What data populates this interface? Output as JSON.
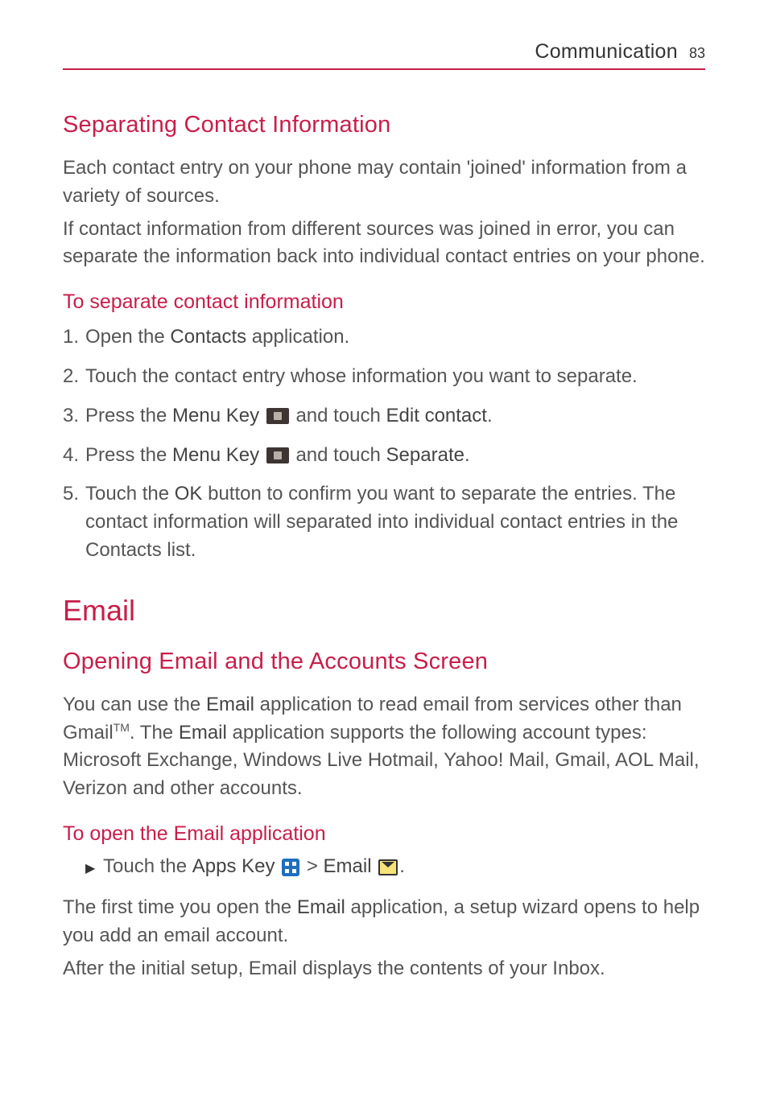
{
  "header": {
    "chapter": "Communication",
    "page": "83"
  },
  "section1": {
    "title": "Separating Contact Information",
    "para1": "Each contact entry on your phone may contain 'joined' information from a variety of sources.",
    "para2": "If contact information from different sources was joined in error, you can separate the information back into individual contact entries on your phone.",
    "sub1": "To separate contact information",
    "steps": {
      "n1": "1.",
      "s1a": "Open the ",
      "s1b": "Contacts",
      "s1c": " application.",
      "n2": "2.",
      "s2": "Touch the contact entry whose information you want to separate.",
      "n3": "3.",
      "s3a": "Press the ",
      "s3b": "Menu Key",
      "s3c": " and touch ",
      "s3d": "Edit contact",
      "s3e": ".",
      "n4": "4.",
      "s4a": "Press the ",
      "s4b": "Menu Key",
      "s4c": " and touch ",
      "s4d": "Separate",
      "s4e": ".",
      "n5": "5.",
      "s5a": "Touch the ",
      "s5b": "OK",
      "s5c": " button to confirm you want to separate the entries. The contact information will separated into individual contact entries in the Contacts list."
    }
  },
  "section2": {
    "title": "Email",
    "subtitle": "Opening Email and the Accounts Screen",
    "p1a": "You can use the ",
    "p1b": "Email",
    "p1c": " application to read email from services other than Gmail",
    "p1sup": "TM",
    "p1d": ". The ",
    "p1e": "Email",
    "p1f": " application supports the following account types: Microsoft Exchange, Windows Live Hotmail, Yahoo! Mail, Gmail, AOL Mail, Verizon and other accounts.",
    "sub2": "To open the Email application",
    "bullet_a": "Touch the ",
    "bullet_b": "Apps Key",
    "bullet_c": " > ",
    "bullet_d": "Email",
    "bullet_e": ".",
    "p2a": "The first time you open the ",
    "p2b": "Email",
    "p2c": " application, a setup wizard opens to help you add an email account.",
    "p3": "After the initial setup, Email displays the contents of your Inbox."
  }
}
